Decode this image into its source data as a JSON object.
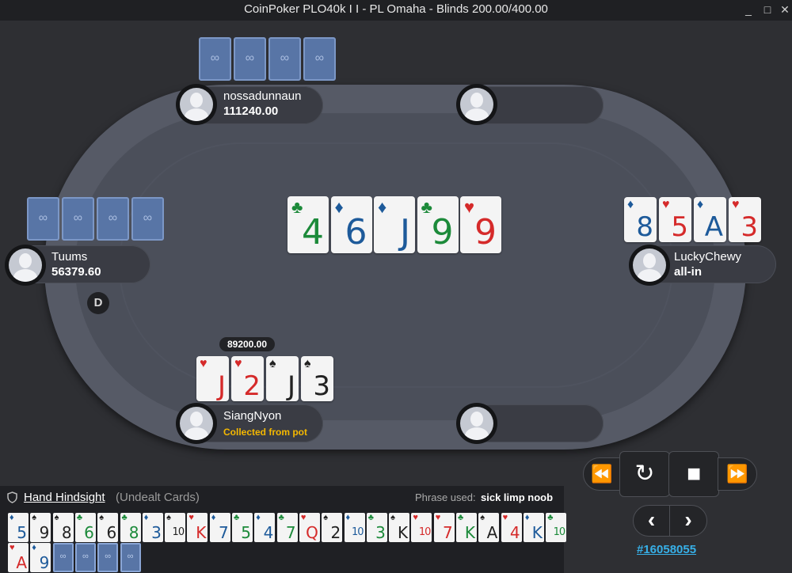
{
  "window": {
    "title": "CoinPoker PLO40k I I - PL Omaha - Blinds 200.00/400.00",
    "minimize_icon": "_",
    "maximize_icon": "□",
    "close_icon": "✕"
  },
  "colors": {
    "red_suit": "#d52a2a",
    "black_suit": "#222222",
    "club_green": "#1c8a3a",
    "diamond_blue": "#1d5a9a",
    "status_gold": "#f5b800",
    "link_blue": "#37b0e8"
  },
  "suit_glyphs": {
    "h": "♥",
    "s": "♠",
    "c": "♣",
    "d": "♦"
  },
  "card_back_logo": "∞",
  "board": {
    "cards": [
      {
        "rank": "4",
        "suit": "c"
      },
      {
        "rank": "6",
        "suit": "d"
      },
      {
        "rank": "J",
        "suit": "d"
      },
      {
        "rank": "9",
        "suit": "c"
      },
      {
        "rank": "9",
        "suit": "h"
      }
    ]
  },
  "players": {
    "top_left": {
      "name": "nossadunnaun",
      "stack": "111240.00"
    },
    "left": {
      "name": "Tuums",
      "stack": "56379.60"
    },
    "right": {
      "name": "LuckyChewy",
      "stack": "all-in",
      "cards": [
        {
          "rank": "8",
          "suit": "d"
        },
        {
          "rank": "5",
          "suit": "h"
        },
        {
          "rank": "A",
          "suit": "d"
        },
        {
          "rank": "3",
          "suit": "h"
        }
      ]
    },
    "bottom": {
      "name": "SiangNyon",
      "status": "Collected from pot",
      "bet": "89200.00",
      "cards": [
        {
          "rank": "J",
          "suit": "h"
        },
        {
          "rank": "2",
          "suit": "h"
        },
        {
          "rank": "J",
          "suit": "s"
        },
        {
          "rank": "3",
          "suit": "s"
        }
      ]
    }
  },
  "dealer_button": "D",
  "controls": {
    "rewind_icon": "⏪",
    "replay_icon": "↻",
    "stop_icon": "■",
    "forward_icon": "⏩",
    "prev_icon": "‹",
    "next_icon": "›",
    "hand_id": "#16058055"
  },
  "hindsight": {
    "icon": "shield",
    "title": "Hand Hindsight",
    "subtitle": "(Undealt Cards)",
    "phrase_label": "Phrase used:",
    "phrase": "sick limp noob",
    "cards": [
      {
        "rank": "5",
        "suit": "d"
      },
      {
        "rank": "9",
        "suit": "s"
      },
      {
        "rank": "8",
        "suit": "s"
      },
      {
        "rank": "6",
        "suit": "c"
      },
      {
        "rank": "6",
        "suit": "s"
      },
      {
        "rank": "8",
        "suit": "c"
      },
      {
        "rank": "3",
        "suit": "d"
      },
      {
        "rank": "10",
        "suit": "s"
      },
      {
        "rank": "K",
        "suit": "h"
      },
      {
        "rank": "7",
        "suit": "d"
      },
      {
        "rank": "5",
        "suit": "c"
      },
      {
        "rank": "4",
        "suit": "d"
      },
      {
        "rank": "7",
        "suit": "c"
      },
      {
        "rank": "Q",
        "suit": "h"
      },
      {
        "rank": "2",
        "suit": "s"
      },
      {
        "rank": "10",
        "suit": "d"
      },
      {
        "rank": "3",
        "suit": "c"
      },
      {
        "rank": "K",
        "suit": "s"
      },
      {
        "rank": "10",
        "suit": "h"
      },
      {
        "rank": "7",
        "suit": "h"
      },
      {
        "rank": "K",
        "suit": "c"
      },
      {
        "rank": "A",
        "suit": "s"
      },
      {
        "rank": "4",
        "suit": "h"
      },
      {
        "rank": "K",
        "suit": "d"
      },
      {
        "rank": "10",
        "suit": "c"
      },
      {
        "rank": "A",
        "suit": "h"
      },
      {
        "rank": "9",
        "suit": "d"
      }
    ],
    "hidden_cards": 4
  }
}
